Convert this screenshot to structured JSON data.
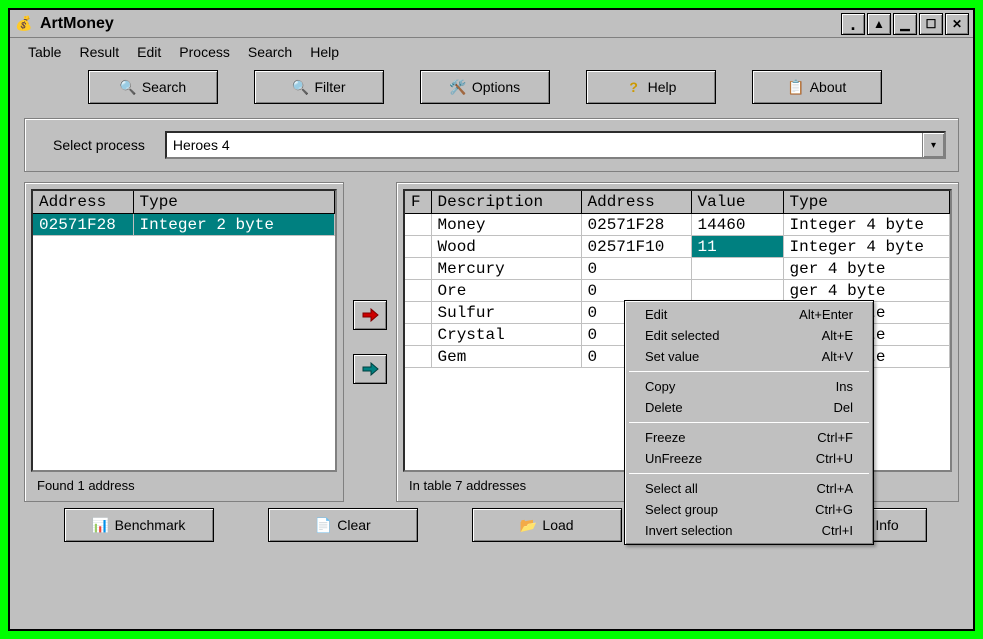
{
  "app": {
    "title": "ArtMoney"
  },
  "menubar": [
    "Table",
    "Result",
    "Edit",
    "Process",
    "Search",
    "Help"
  ],
  "toolbar": {
    "search": "Search",
    "filter": "Filter",
    "options": "Options",
    "help": "Help",
    "about": "About"
  },
  "process": {
    "label": "Select process",
    "value": "Heroes 4"
  },
  "left_table": {
    "headers": [
      "Address",
      "Type"
    ],
    "rows": [
      {
        "address": "02571F28",
        "type": "Integer 2 byte",
        "selected": true
      }
    ],
    "status": "Found 1 address"
  },
  "right_table": {
    "headers": [
      "F",
      "Description",
      "Address",
      "Value",
      "Type"
    ],
    "rows": [
      {
        "f": "",
        "desc": "Money",
        "addr": "02571F28",
        "val": "14460",
        "type": "Integer 4 byte"
      },
      {
        "f": "",
        "desc": "Wood",
        "addr": "02571F10",
        "val": "11",
        "type": "Integer 4 byte",
        "val_selected": true
      },
      {
        "f": "",
        "desc": "Mercury",
        "addr": "0",
        "val": "",
        "type": "ger 4 byte"
      },
      {
        "f": "",
        "desc": "Ore",
        "addr": "0",
        "val": "",
        "type": "ger 4 byte"
      },
      {
        "f": "",
        "desc": "Sulfur",
        "addr": "0",
        "val": "",
        "type": "ger 4 byte"
      },
      {
        "f": "",
        "desc": "Crystal",
        "addr": "0",
        "val": "",
        "type": "ger 4 byte"
      },
      {
        "f": "",
        "desc": "Gem",
        "addr": "0",
        "val": "",
        "type": "ger 4 byte"
      }
    ],
    "status": "In table 7 addresses"
  },
  "context_menu": [
    {
      "label": "Edit",
      "short": "Alt+Enter"
    },
    {
      "label": "Edit selected",
      "short": "Alt+E"
    },
    {
      "label": "Set value",
      "short": "Alt+V"
    },
    {
      "sep": true
    },
    {
      "label": "Copy",
      "short": "Ins"
    },
    {
      "label": "Delete",
      "short": "Del"
    },
    {
      "sep": true
    },
    {
      "label": "Freeze",
      "short": "Ctrl+F"
    },
    {
      "label": "UnFreeze",
      "short": "Ctrl+U"
    },
    {
      "sep": true
    },
    {
      "label": "Select all",
      "short": "Ctrl+A"
    },
    {
      "label": "Select group",
      "short": "Ctrl+G"
    },
    {
      "label": "Invert selection",
      "short": "Ctrl+I"
    }
  ],
  "bottom_toolbar": {
    "benchmark": "Benchmark",
    "clear": "Clear",
    "load": "Load",
    "info": "Info"
  }
}
